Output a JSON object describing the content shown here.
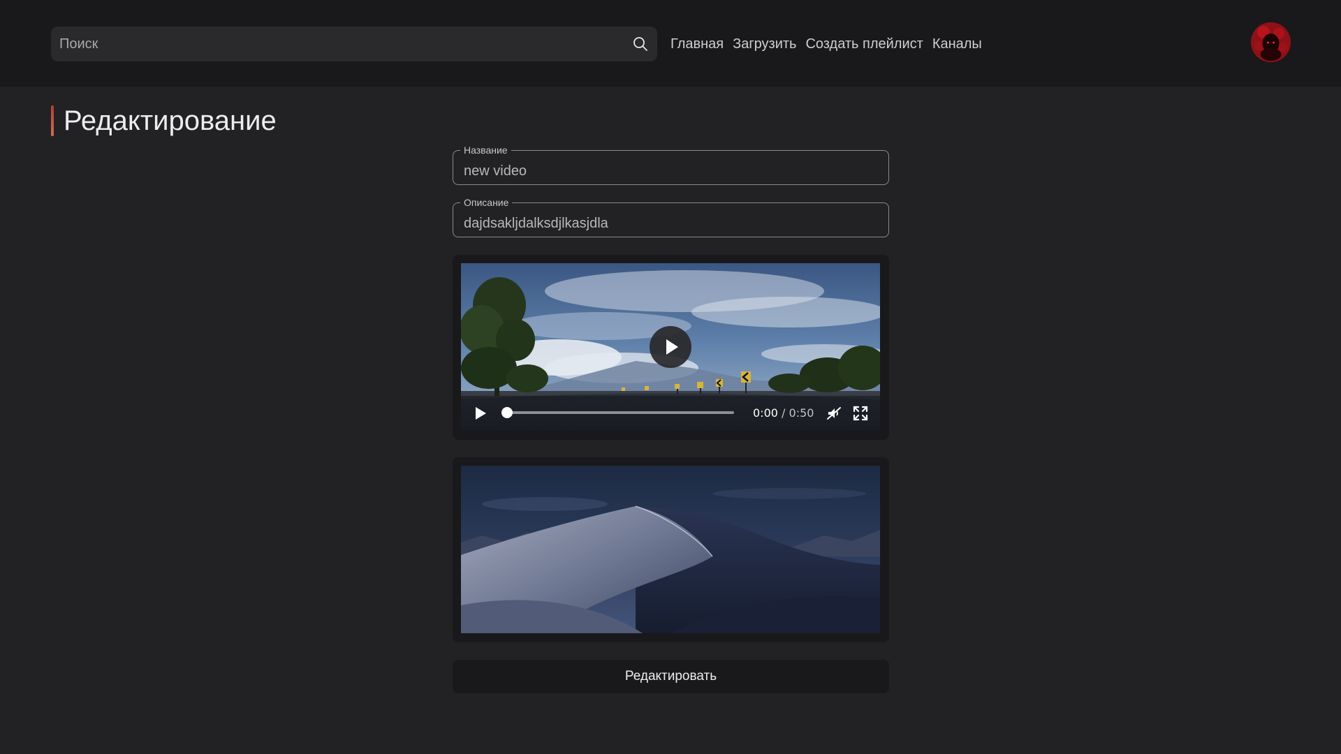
{
  "header": {
    "search": {
      "placeholder": "Поиск",
      "value": ""
    },
    "nav": [
      {
        "label": "Главная"
      },
      {
        "label": "Загрузить"
      },
      {
        "label": "Создать плейлист"
      },
      {
        "label": "Каналы"
      }
    ],
    "avatar_icon": "user-avatar"
  },
  "page": {
    "title": "Редактирование",
    "accent_colors": [
      "#b33d3d",
      "#d46d4a"
    ]
  },
  "form": {
    "name": {
      "label": "Название",
      "value": "new video"
    },
    "description": {
      "label": "Описание",
      "value": "dajdsakljdalksdjlkasjdla"
    },
    "video": {
      "current_time": "0:00",
      "separator": "/",
      "duration": "0:50",
      "progress": 0,
      "muted": true,
      "icons": [
        "play-icon",
        "mute-icon",
        "fullscreen-icon"
      ]
    },
    "thumbnail_icon": "dune-landscape-image",
    "submit_label": "Редактировать"
  },
  "colors": {
    "background": "#222225",
    "header": "#19191b",
    "card": "#19191b"
  }
}
